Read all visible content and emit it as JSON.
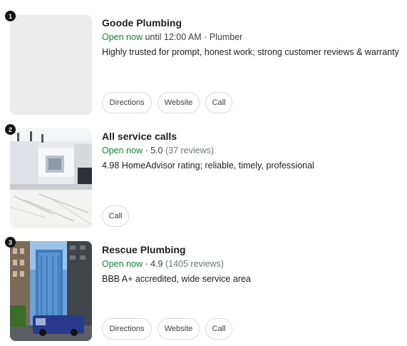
{
  "results": [
    {
      "number": "1",
      "name": "Goode Plumbing",
      "status": "Open now",
      "status_rest": " until 12:00 AM · Plumber",
      "description": "Highly trusted for prompt, honest work; strong customer reviews & warranty",
      "buttons": {
        "directions": "Directions",
        "website": "Website",
        "call": "Call"
      }
    },
    {
      "number": "2",
      "name": "All service calls",
      "status": "Open now",
      "rating_sep": " · ",
      "rating": "5.0",
      "reviews": " (37 reviews)",
      "description": "4.98 HomeAdvisor rating; reliable, timely, professional",
      "buttons": {
        "call": "Call"
      }
    },
    {
      "number": "3",
      "name": "Rescue Plumbing",
      "status": "Open now",
      "rating_sep": " · ",
      "rating": "4.9",
      "reviews": " (1405 reviews)",
      "description": "BBB A+ accredited, wide service area",
      "buttons": {
        "directions": "Directions",
        "website": "Website",
        "call": "Call"
      }
    }
  ]
}
